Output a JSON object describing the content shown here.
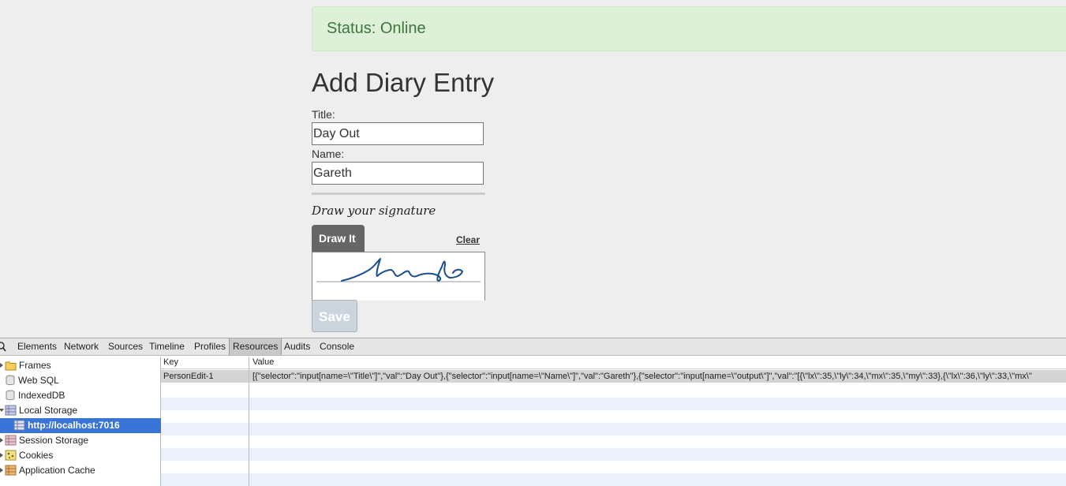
{
  "status": {
    "text": "Status: Online"
  },
  "form": {
    "heading": "Add Diary Entry",
    "title_label": "Title:",
    "title_value": "Day Out",
    "name_label": "Name:",
    "name_value": "Gareth",
    "signature_hint": "Draw your signature",
    "draw_tab": "Draw It",
    "clear_link": "Clear",
    "save_button": "Save"
  },
  "devtools": {
    "tabs": [
      "Elements",
      "Network",
      "Sources",
      "Timeline",
      "Profiles",
      "Resources",
      "Audits",
      "Console"
    ],
    "active_tab": "Resources",
    "tree": [
      {
        "label": "Frames",
        "icon": "folder-icon"
      },
      {
        "label": "Web SQL",
        "icon": "database-icon"
      },
      {
        "label": "IndexedDB",
        "icon": "database-icon"
      },
      {
        "label": "Local Storage",
        "icon": "grid-icon"
      },
      {
        "label": "http://localhost:7016",
        "icon": "grid-icon"
      },
      {
        "label": "Session Storage",
        "icon": "grid-icon"
      },
      {
        "label": "Cookies",
        "icon": "cookie-icon"
      },
      {
        "label": "Application Cache",
        "icon": "grid-icon"
      }
    ],
    "grid": {
      "key_header": "Key",
      "value_header": "Value",
      "rows": [
        {
          "key": "PersonEdit-1",
          "value": "[{\"selector\":\"input[name=\\\"Title\\\"]\",\"val\":\"Day Out\"},{\"selector\":\"input[name=\\\"Name\\\"]\",\"val\":\"Gareth\"},{\"selector\":\"input[name=\\\"output\\\"]\",\"val\":\"[{\\\"lx\\\":35,\\\"ly\\\":34,\\\"mx\\\":35,\\\"my\\\":33},{\\\"lx\\\":36,\\\"ly\\\":33,\\\"mx\\\""
        }
      ]
    }
  },
  "colors": {
    "status_bg": "#dff0d8",
    "status_text": "#3c763d",
    "selected_tree": "#3875d7",
    "signature_ink": "#1a4f8f"
  }
}
